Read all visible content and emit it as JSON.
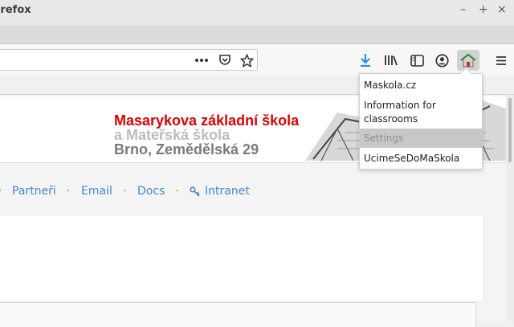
{
  "window": {
    "title": "irefox",
    "minimize_glyph": "–",
    "maximize_glyph": "+",
    "close_glyph": "×"
  },
  "toolbar": {
    "icons": [
      "page-actions-icon",
      "pocket-icon",
      "bookmark-star-icon",
      "downloads-icon",
      "library-icon",
      "sidebar-icon",
      "account-icon",
      "school-extension-icon",
      "menu-icon"
    ],
    "accent_color": "#1a8cff"
  },
  "banner": {
    "line1": "Masarykova základní škola",
    "line2": "a Mateřská škola",
    "line3": "Brno, Zemědělská 29",
    "line1_color": "#e00000"
  },
  "site_nav": {
    "links": [
      "Partneři",
      "Email",
      "Docs",
      "Intranet"
    ],
    "separator": "·",
    "intranet_icon": "key-icon"
  },
  "extension_popup": {
    "items": [
      "Maskola.cz",
      "Information for classrooms",
      "Settings",
      "UcimeSeDoMaSkola"
    ],
    "highlighted_item": "Settings"
  }
}
